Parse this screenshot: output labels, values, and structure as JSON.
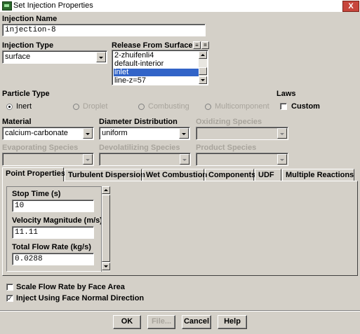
{
  "window": {
    "title": "Set Injection Properties",
    "close_label": "X"
  },
  "injection_name": {
    "label": "Injection Name",
    "value": "injection-8"
  },
  "injection_type": {
    "label": "Injection Type",
    "value": "surface"
  },
  "release": {
    "label": "Release From Surfaces",
    "items": [
      "2-zhuifenli4",
      "default-interior",
      "inlet",
      "line-z=57"
    ],
    "selected": "inlet"
  },
  "particle_type": {
    "label": "Particle Type",
    "options": [
      "Inert",
      "Droplet",
      "Combusting",
      "Multicomponent"
    ],
    "selected": "Inert"
  },
  "laws": {
    "label": "Laws",
    "custom_label": "Custom",
    "custom_checked": false
  },
  "material": {
    "label": "Material",
    "value": "calcium-carbonate"
  },
  "diameter_distribution": {
    "label": "Diameter Distribution",
    "value": "uniform"
  },
  "oxidizing_species": {
    "label": "Oxidizing Species",
    "value": ""
  },
  "evaporating_species": {
    "label": "Evaporating Species",
    "value": ""
  },
  "devolatilizing_species": {
    "label": "Devolatilizing Species",
    "value": ""
  },
  "product_species": {
    "label": "Product Species",
    "value": ""
  },
  "tabs": [
    {
      "label": "Point Properties",
      "active": true
    },
    {
      "label": "Turbulent Dispersion",
      "active": false
    },
    {
      "label": "Wet Combustion",
      "active": false
    },
    {
      "label": "Components",
      "active": false
    },
    {
      "label": "UDF",
      "active": false
    },
    {
      "label": "Multiple Reactions",
      "active": false
    }
  ],
  "point_properties": {
    "stop_time": {
      "label": "Stop Time (s)",
      "value": "10"
    },
    "velocity_magnitude": {
      "label": "Velocity Magnitude (m/s)",
      "value": "11.11"
    },
    "total_flow_rate": {
      "label": "Total Flow Rate (kg/s)",
      "value": "0.0288"
    }
  },
  "options": {
    "scale_flow_rate": {
      "label": "Scale Flow Rate by Face Area",
      "checked": false
    },
    "inject_face_normal": {
      "label": "Inject Using Face Normal Direction",
      "checked": true
    }
  },
  "buttons": {
    "ok": "OK",
    "file": "File...",
    "cancel": "Cancel",
    "help": "Help"
  },
  "icons": {
    "list_tool_1": "≡",
    "list_tool_2": "="
  }
}
